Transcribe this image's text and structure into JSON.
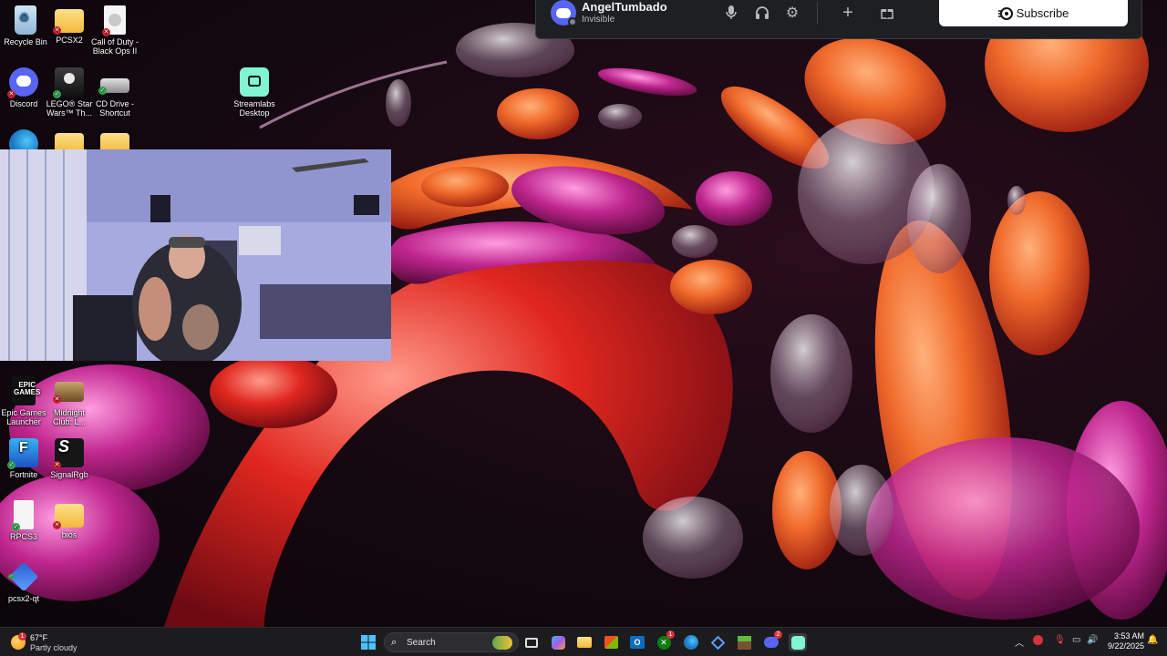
{
  "desktop": {
    "icons": [
      {
        "label": "Recycle Bin",
        "icon": "recycle-bin-icon"
      },
      {
        "label": "PCSX2",
        "icon": "folder-icon"
      },
      {
        "label": "Call of Duty - Black Ops II",
        "icon": "file-icon"
      },
      {
        "label": "Discord",
        "icon": "discord-icon"
      },
      {
        "label": "LEGO® Star Wars™ Th...",
        "icon": "lego-star-wars-icon"
      },
      {
        "label": "CD Drive - Shortcut",
        "icon": "cd-drive-icon"
      },
      {
        "label": "Streamlabs Desktop",
        "icon": "streamlabs-icon"
      },
      {
        "label": "Epic Games Launcher",
        "icon": "epic-games-icon"
      },
      {
        "label": "Midnight Club: L...",
        "icon": "midnight-club-icon"
      },
      {
        "label": "Fortnite",
        "icon": "fortnite-icon"
      },
      {
        "label": "SignalRgb",
        "icon": "signalrgb-icon"
      },
      {
        "label": "RPCS3",
        "icon": "file-icon"
      },
      {
        "label": "bios",
        "icon": "folder-icon"
      },
      {
        "label": "pcsx2-qt",
        "icon": "pcsx2-qt-icon"
      }
    ]
  },
  "discord": {
    "username": "AngelTumbado",
    "status": "Invisible",
    "subscribe_label": "Subscribe"
  },
  "taskbar": {
    "weather_temp": "67°F",
    "weather_condition": "Partly cloudy",
    "weather_badge": "1",
    "search_placeholder": "Search",
    "xbox_badge": "1",
    "discord_badge": "2",
    "time": "3:53 AM",
    "date": "9/22/2025"
  },
  "colors": {
    "discord_brand": "#5865f2",
    "taskbar_bg": "#1c1c1f",
    "panel_bg": "#1e1f22"
  }
}
